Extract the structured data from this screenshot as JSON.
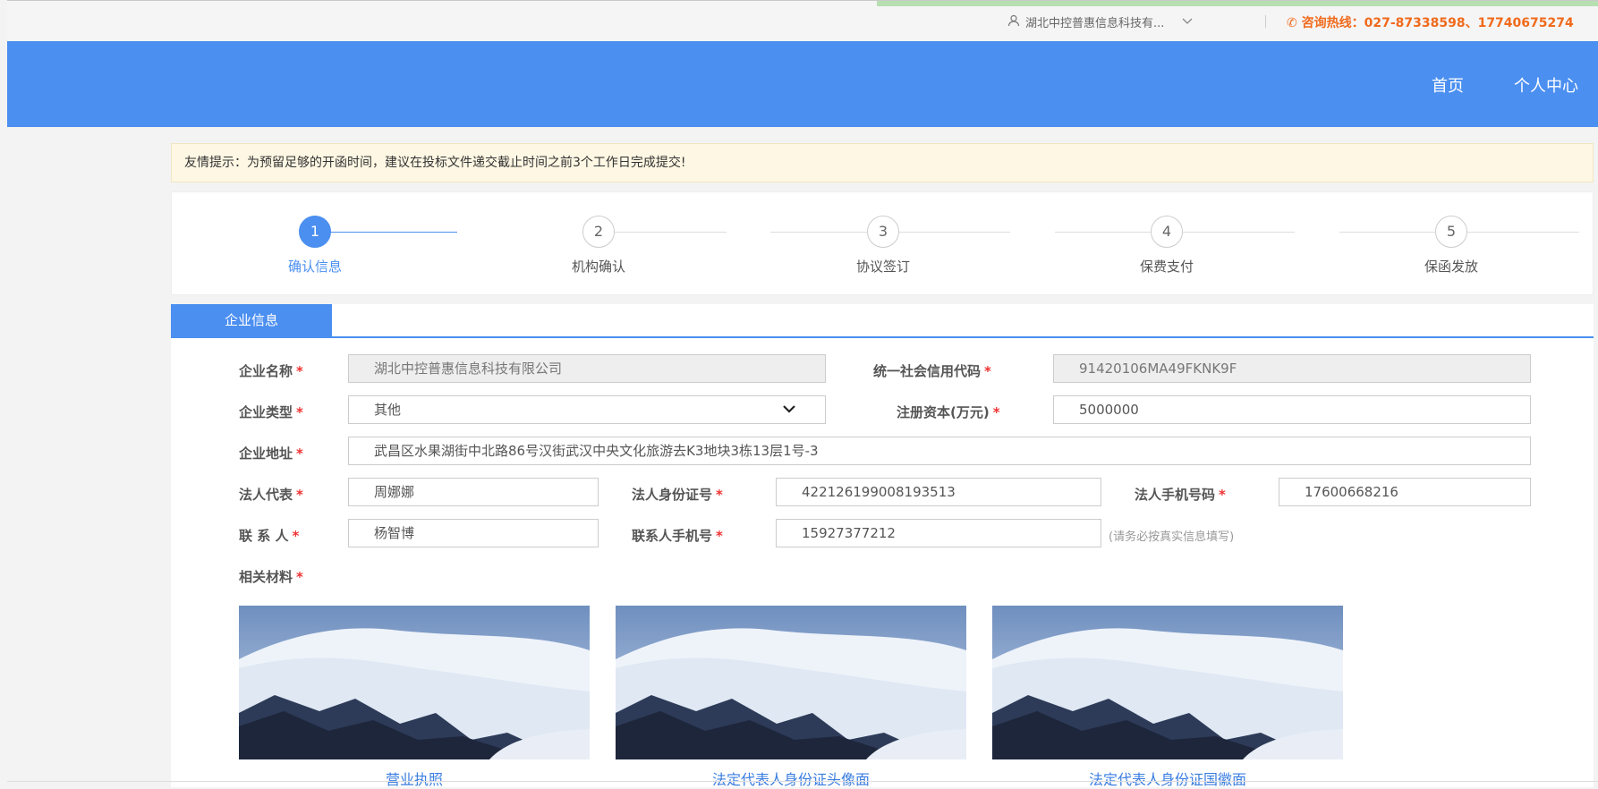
{
  "topbar": {
    "company": "湖北中控普惠信息科技有...",
    "hotline": "咨询热线：027-87338598、17740675274"
  },
  "nav": {
    "home": "首页",
    "center": "个人中心"
  },
  "tip": "友情提示：为预留足够的开函时间，建议在投标文件递交截止时间之前3个工作日完成提交!",
  "steps": [
    {
      "num": "1",
      "label": "确认信息"
    },
    {
      "num": "2",
      "label": "机构确认"
    },
    {
      "num": "3",
      "label": "协议签订"
    },
    {
      "num": "4",
      "label": "保费支付"
    },
    {
      "num": "5",
      "label": "保函发放"
    }
  ],
  "tab": "企业信息",
  "form": {
    "company_name": {
      "label": "企业名称",
      "value": "湖北中控普惠信息科技有限公司"
    },
    "credit_code": {
      "label": "统一社会信用代码",
      "value": "91420106MA49FKNK9F"
    },
    "company_type": {
      "label": "企业类型",
      "value": "其他"
    },
    "reg_capital": {
      "label": "注册资本(万元)",
      "value": "5000000"
    },
    "address": {
      "label": "企业地址",
      "value": "武昌区水果湖街中北路86号汉街武汉中央文化旅游去K3地块3栋13层1号-3"
    },
    "legal_rep": {
      "label": "法人代表",
      "value": "周娜娜"
    },
    "legal_id": {
      "label": "法人身份证号",
      "value": "422126199008193513"
    },
    "legal_phone": {
      "label": "法人手机号码",
      "value": "17600668216"
    },
    "contact": {
      "label": "联 系 人",
      "value": "杨智博"
    },
    "contact_phone": {
      "label": "联系人手机号",
      "value": "15927377212"
    },
    "contact_hint": "(请务必按真实信息填写)",
    "materials_label": "相关材料",
    "required_mark": "*"
  },
  "materials": [
    {
      "caption": "营业执照"
    },
    {
      "caption": "法定代表人身份证头像面"
    },
    {
      "caption": "法定代表人身份证国徽面"
    }
  ]
}
